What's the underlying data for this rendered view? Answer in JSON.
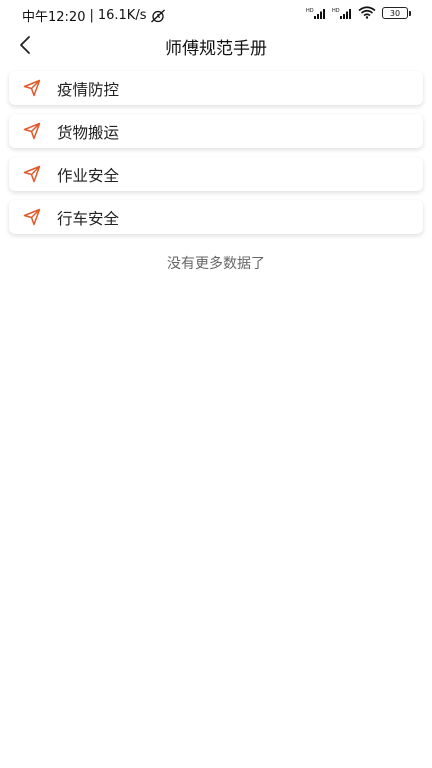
{
  "status_bar": {
    "time": "中午12:20",
    "separator": "|",
    "speed": "16.1K/s",
    "battery": "30",
    "icons": [
      "alarm-off-icon",
      "hd-signal-icon",
      "hd-signal-icon",
      "wifi-icon",
      "battery-icon"
    ]
  },
  "header": {
    "title": "师傅规范手册",
    "back_icon": "chevron-left-icon"
  },
  "list": {
    "items": [
      {
        "label": "疫情防控",
        "icon": "send-icon"
      },
      {
        "label": "货物搬运",
        "icon": "send-icon"
      },
      {
        "label": "作业安全",
        "icon": "send-icon"
      },
      {
        "label": "行车安全",
        "icon": "send-icon"
      }
    ]
  },
  "footer_text": "没有更多数据了",
  "colors": {
    "accent": "#e0592a",
    "background": "#ffffff",
    "text": "#222222",
    "muted": "#666666"
  }
}
